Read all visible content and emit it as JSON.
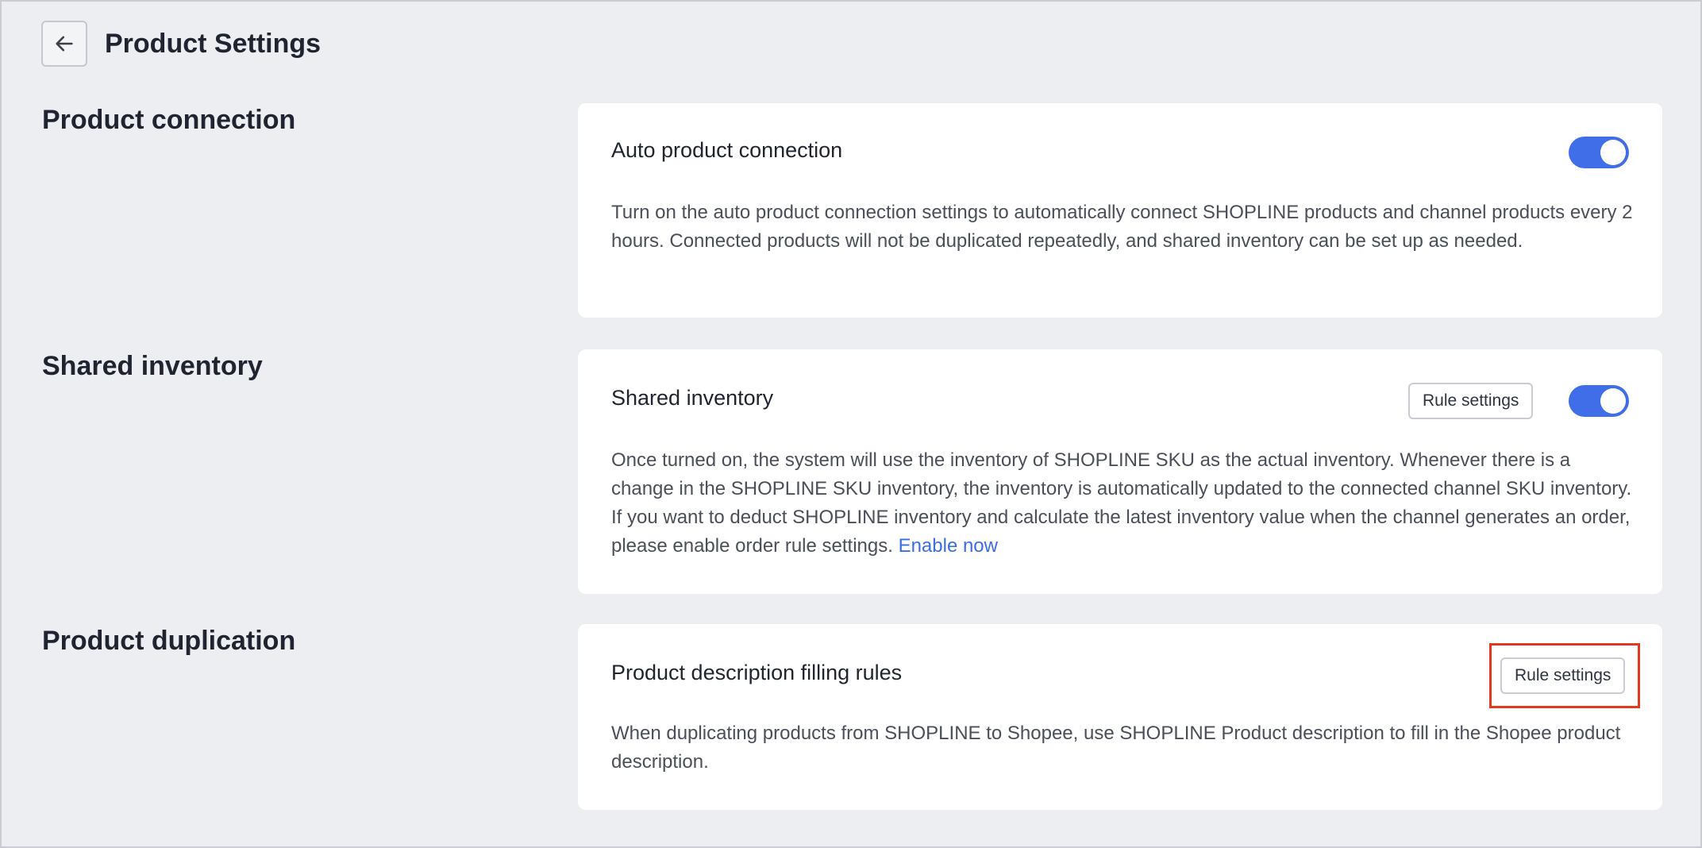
{
  "header": {
    "back_icon": "arrow-left-icon",
    "title": "Product Settings"
  },
  "sections": [
    {
      "heading": "Product connection",
      "card": {
        "title": "Auto product connection",
        "toggle_on": true,
        "description": "Turn on the auto product connection settings to automatically connect SHOPLINE products and channel products every 2 hours. Connected products will not be duplicated repeatedly, and shared inventory can be set up as needed."
      }
    },
    {
      "heading": "Shared inventory",
      "card": {
        "title": "Shared inventory",
        "button_label": "Rule settings",
        "toggle_on": true,
        "description": "Once turned on, the system will use the inventory of SHOPLINE SKU as the actual inventory. Whenever there is a change in the SHOPLINE SKU inventory, the inventory is automatically updated to the connected channel SKU inventory. If you want to deduct SHOPLINE inventory and calculate the latest inventory value when the channel generates an order, please enable order rule settings.",
        "link_label": "Enable now"
      }
    },
    {
      "heading": "Product duplication",
      "card": {
        "title": "Product description filling rules",
        "button_label": "Rule settings",
        "description": "When duplicating products from SHOPLINE to Shopee, use SHOPLINE Product description to fill in the Shopee product description."
      }
    }
  ],
  "colors": {
    "accent": "#3f6ee8",
    "link": "#3b6ee6",
    "highlight": "#e23a1f",
    "background": "#eceef2"
  }
}
